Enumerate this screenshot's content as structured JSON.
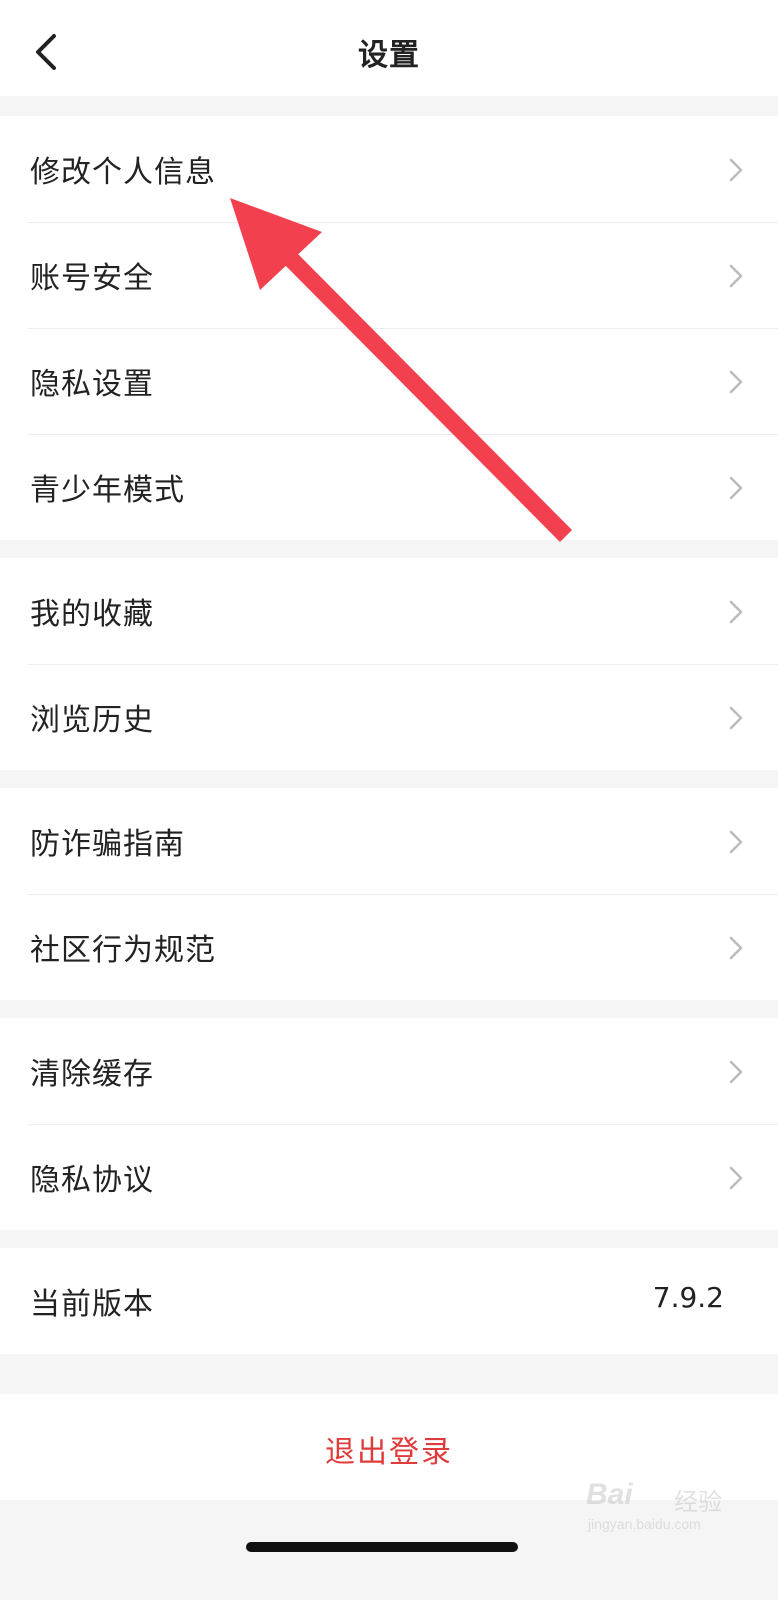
{
  "header": {
    "title": "设置",
    "back_icon": "chevron-left-icon"
  },
  "groups": [
    {
      "items": [
        {
          "label": "修改个人信息"
        },
        {
          "label": "账号安全"
        },
        {
          "label": "隐私设置"
        },
        {
          "label": "青少年模式"
        }
      ]
    },
    {
      "items": [
        {
          "label": "我的收藏"
        },
        {
          "label": "浏览历史"
        }
      ]
    },
    {
      "items": [
        {
          "label": "防诈骗指南"
        },
        {
          "label": "社区行为规范"
        }
      ]
    },
    {
      "items": [
        {
          "label": "清除缓存"
        },
        {
          "label": "隐私协议"
        }
      ]
    }
  ],
  "version": {
    "label": "当前版本",
    "value": "7.9.2"
  },
  "logout": {
    "label": "退出登录",
    "color": "#e03b3b"
  },
  "annotation": {
    "color": "#f2404f"
  },
  "watermark": {
    "logo": "Bai",
    "text": "经验",
    "sub": "jingyan.baidu.com"
  }
}
